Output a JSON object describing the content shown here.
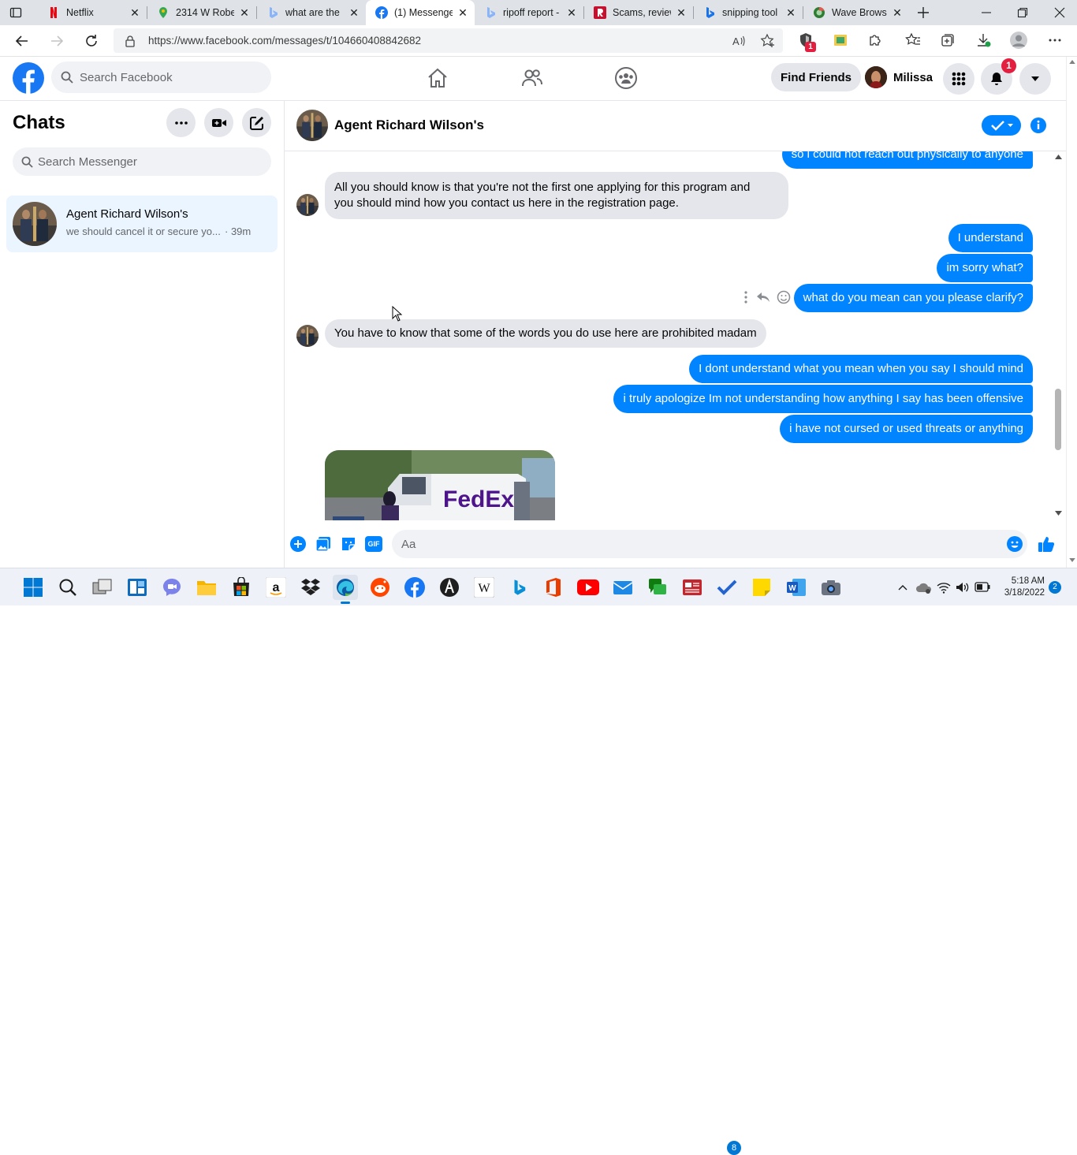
{
  "browser": {
    "tabs": [
      {
        "label": "Netflix"
      },
      {
        "label": "2314 W Robe"
      },
      {
        "label": "what are the"
      },
      {
        "label": "(1) Messenge"
      },
      {
        "label": "ripoff report -"
      },
      {
        "label": "Scams, review"
      },
      {
        "label": "snipping tool"
      },
      {
        "label": "Wave Browse"
      }
    ],
    "url": "https://www.facebook.com/messages/t/104660408842682",
    "extension_badge": "1"
  },
  "facebook": {
    "search_placeholder": "Search Facebook",
    "find_friends_label": "Find Friends",
    "profile_name": "Milissa",
    "notification_count": "1"
  },
  "sidebar": {
    "title": "Chats",
    "search_placeholder": "Search Messenger",
    "conversations": [
      {
        "name": "Agent Richard Wilson's",
        "preview": "we should cancel it or secure yo...",
        "time": "· 39m"
      }
    ]
  },
  "chat": {
    "contact_name": "Agent Richard Wilson's",
    "messages": [
      {
        "dir": "out",
        "text": "so i could not reach out physically to anyone"
      },
      {
        "dir": "in",
        "text_lines": [
          "All you should know is that you're not the first one applying for this program and",
          "you should mind how you contact us here in the registration page."
        ]
      },
      {
        "dir": "out",
        "text": "I understand"
      },
      {
        "dir": "out",
        "text": "im sorry what?"
      },
      {
        "dir": "out",
        "text": "what do you mean can you please clarify?"
      },
      {
        "dir": "in",
        "text": "You have to know that some of the words you do use here are prohibited madam"
      },
      {
        "dir": "out",
        "text": "I dont understand what you mean when you say I should mind"
      },
      {
        "dir": "out",
        "text": "i truly apologize Im not understanding how anything I say has been offensive"
      },
      {
        "dir": "out",
        "text": "i have not cursed or used threats or anything"
      }
    ],
    "image_text": "FedEx",
    "composer_placeholder": "Aa",
    "gif_label": "GIF"
  },
  "taskbar": {
    "time": "5:18 AM",
    "date": "3/18/2022",
    "notification_count": "2",
    "todo_badge": "8"
  },
  "colors": {
    "messenger_blue": "#0084ff",
    "facebook_blue": "#1877f2",
    "incoming_bubble": "#e4e6eb",
    "badge_red": "#e41e3f"
  }
}
